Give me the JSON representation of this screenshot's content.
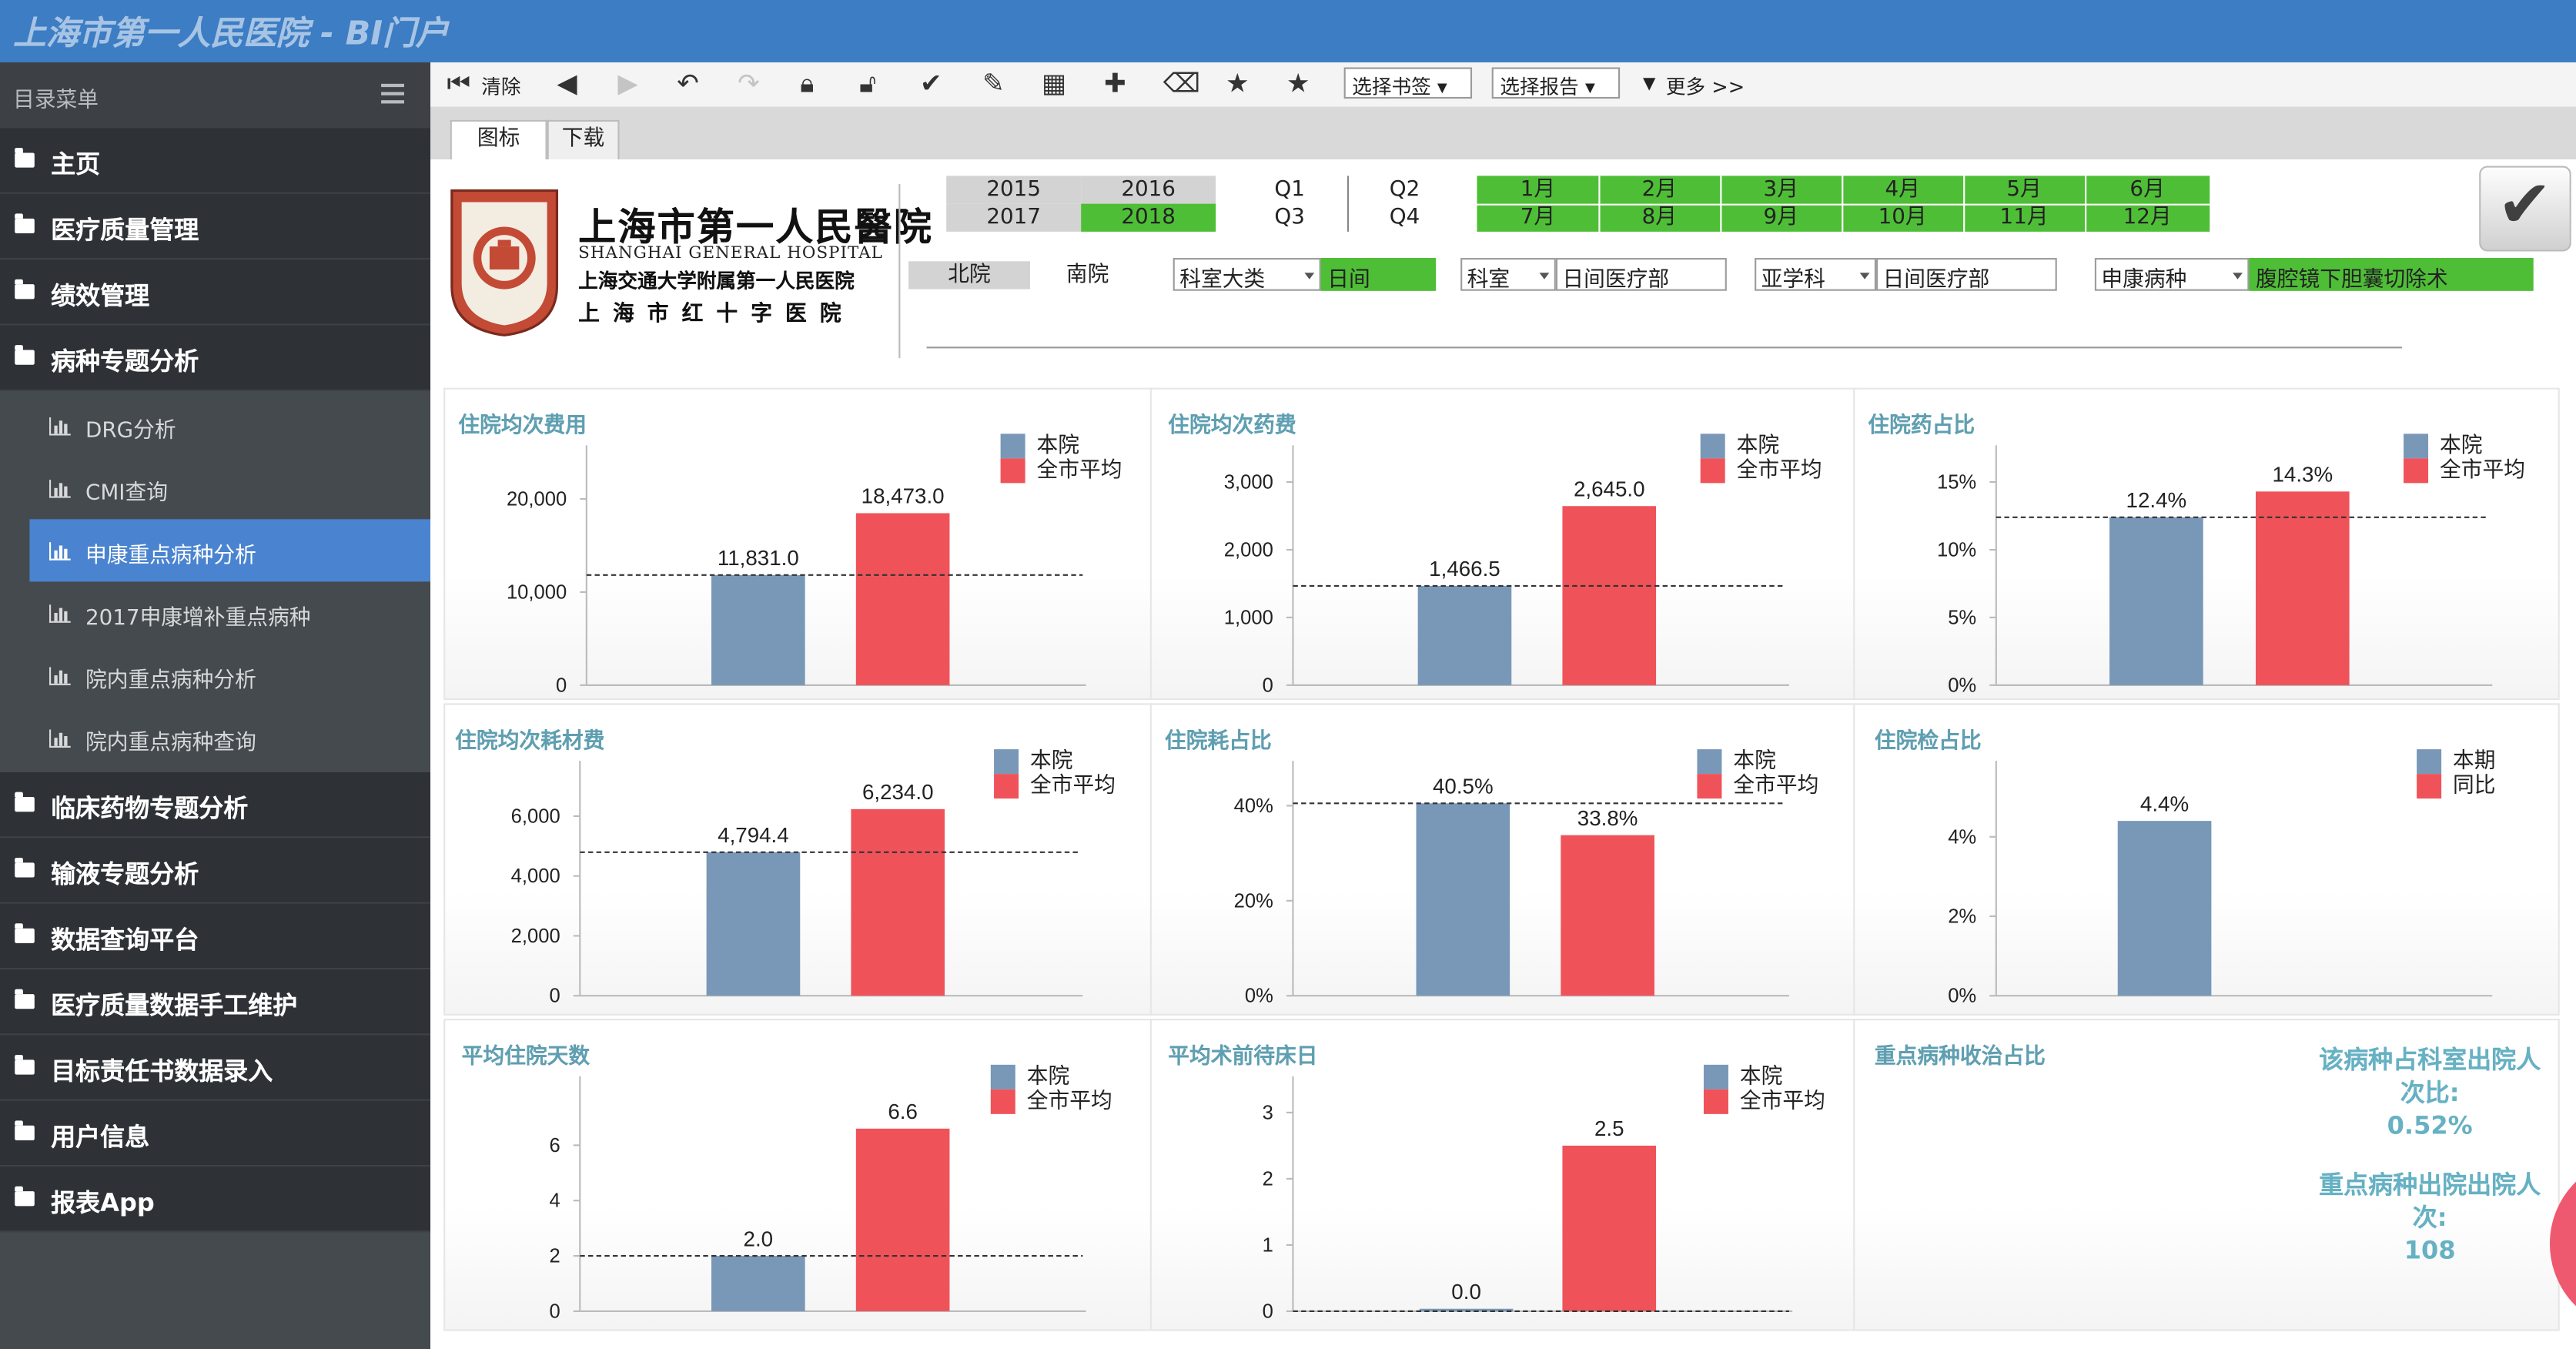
{
  "app": {
    "title": "上海市第一人民医院 - BI门户"
  },
  "sidebar": {
    "header": "目录菜单",
    "items": [
      {
        "label": "主页"
      },
      {
        "label": "医疗质量管理"
      },
      {
        "label": "绩效管理"
      },
      {
        "label": "病种专题分析"
      },
      {
        "label": "临床药物专题分析"
      },
      {
        "label": "输液专题分析"
      },
      {
        "label": "数据查询平台"
      },
      {
        "label": "医疗质量数据手工维护"
      },
      {
        "label": "目标责任书数据录入"
      },
      {
        "label": "用户信息"
      },
      {
        "label": "报表App"
      }
    ],
    "subitems": [
      {
        "label": "DRG分析"
      },
      {
        "label": "CMI查询"
      },
      {
        "label": "申康重点病种分析"
      },
      {
        "label": "2017申康增补重点病种"
      },
      {
        "label": "院内重点病种分析"
      },
      {
        "label": "院内重点病种查询"
      }
    ],
    "active_subitem": "申康重点病种分析"
  },
  "toolbar": {
    "clear_label": "清除",
    "bookmark_select": "选择书签",
    "report_select": "选择报告",
    "more_label": "更多 >>"
  },
  "tabs": [
    {
      "label": "图标"
    },
    {
      "label": "下载"
    }
  ],
  "logo": {
    "name_cn": "上海市第一人民醫院",
    "name_en": "SHANGHAI GENERAL HOSPITAL",
    "affiliation": "上海交通大学附属第一人民医院",
    "alt_name": "上海市红十字医院",
    "seal_text": "上海市第一人民医院"
  },
  "filters": {
    "years": {
      "row1": [
        "2015",
        "2016"
      ],
      "row2": [
        "2017",
        "2018"
      ],
      "selected": "2018"
    },
    "quarters": {
      "row1": [
        "Q1",
        "Q2"
      ],
      "row2": [
        "Q3",
        "Q4"
      ]
    },
    "months": {
      "row1": [
        "1月",
        "2月",
        "3月",
        "4月",
        "5月",
        "6月"
      ],
      "row2": [
        "7月",
        "8月",
        "9月",
        "10月",
        "11月",
        "12月"
      ]
    },
    "campus": {
      "north": "北院",
      "south": "南院",
      "selected": "北院"
    },
    "dept_category": {
      "label": "科室大类",
      "value": "日间"
    },
    "dept": {
      "label": "科室",
      "value": "日间医疗部"
    },
    "subspecialty": {
      "label": "亚学科",
      "value": "日间医疗部"
    },
    "disease": {
      "label": "申康病种",
      "value": "腹腔镜下胆囊切除术"
    }
  },
  "colors": {
    "hospital": "#7998b8",
    "city": "#ef5359",
    "accent_green": "#4fbe37",
    "title_teal": "#5f9fb1",
    "header_blue": "#3c7dc4"
  },
  "legend": {
    "hospital": "本院",
    "city_avg": "全市平均",
    "current": "本期",
    "yoy": "同比"
  },
  "chart_data": [
    {
      "type": "bar",
      "title": "住院均次费用",
      "categories": [
        "本院",
        "全市平均"
      ],
      "values": [
        11831.0,
        18473.0
      ],
      "labels": [
        "11,831.0",
        "18,473.0"
      ],
      "yticks": [
        0,
        10000,
        20000
      ],
      "ytick_labels": [
        "0",
        "10,000",
        "20,000"
      ],
      "ylim": [
        0,
        24000
      ],
      "reference_line": 11831.0
    },
    {
      "type": "bar",
      "title": "住院均次药费",
      "categories": [
        "本院",
        "全市平均"
      ],
      "values": [
        1466.5,
        2645.0
      ],
      "labels": [
        "1,466.5",
        "2,645.0"
      ],
      "yticks": [
        0,
        1000,
        2000,
        3000
      ],
      "ytick_labels": [
        "0",
        "1,000",
        "2,000",
        "3,000"
      ],
      "ylim": [
        0,
        3300
      ],
      "reference_line": 1466.5
    },
    {
      "type": "bar",
      "title": "住院药占比",
      "categories": [
        "本院",
        "全市平均"
      ],
      "values": [
        12.4,
        14.3
      ],
      "labels": [
        "12.4%",
        "14.3%"
      ],
      "yticks": [
        0,
        5,
        10,
        15
      ],
      "ytick_labels": [
        "0%",
        "5%",
        "10%",
        "15%"
      ],
      "ylim": [
        0,
        16.5
      ],
      "reference_line": 12.4
    },
    {
      "type": "bar",
      "title": "住院均次耗材费",
      "categories": [
        "本院",
        "全市平均"
      ],
      "values": [
        4794.4,
        6234.0
      ],
      "labels": [
        "4,794.4",
        "6,234.0"
      ],
      "yticks": [
        0,
        2000,
        4000,
        6000
      ],
      "ytick_labels": [
        "0",
        "2,000",
        "4,000",
        "6,000"
      ],
      "ylim": [
        0,
        7300
      ],
      "reference_line": 4794.4
    },
    {
      "type": "bar",
      "title": "住院耗占比",
      "categories": [
        "本院",
        "全市平均"
      ],
      "values": [
        40.5,
        33.8
      ],
      "labels": [
        "40.5%",
        "33.8%"
      ],
      "yticks": [
        0,
        20,
        40
      ],
      "ytick_labels": [
        "0%",
        "20%",
        "40%"
      ],
      "ylim": [
        0,
        46
      ],
      "reference_line": 40.5
    },
    {
      "type": "bar",
      "title": "住院检占比",
      "categories": [
        "本期"
      ],
      "values": [
        4.4
      ],
      "labels": [
        "4.4%"
      ],
      "yticks": [
        0,
        2,
        4
      ],
      "ytick_labels": [
        "0%",
        "2%",
        "4%"
      ],
      "ylim": [
        0,
        5.5
      ]
    },
    {
      "type": "bar",
      "title": "平均住院天数",
      "categories": [
        "本院",
        "全市平均"
      ],
      "values": [
        2.0,
        6.6
      ],
      "labels": [
        "2.0",
        "6.6"
      ],
      "yticks": [
        0,
        2,
        4,
        6
      ],
      "ytick_labels": [
        "0",
        "2",
        "4",
        "6"
      ],
      "ylim": [
        0,
        7.9
      ],
      "reference_line": 2.0
    },
    {
      "type": "bar",
      "title": "平均术前待床日",
      "categories": [
        "本院",
        "全市平均"
      ],
      "values": [
        0.0,
        2.5
      ],
      "labels": [
        "0.0",
        "2.5"
      ],
      "yticks": [
        0,
        1,
        2,
        3
      ],
      "ytick_labels": [
        "0",
        "1",
        "2",
        "3"
      ],
      "ylim": [
        0,
        3.3
      ],
      "reference_line": 0.0
    },
    {
      "type": "pie",
      "title": "重点病种收治占比",
      "slices": [
        {
          "label": "该病种占科室出院人次比",
          "value": 0.52,
          "display": "0.52%"
        },
        {
          "label": "重点病种出院出院人次",
          "value": 108,
          "display": "108"
        }
      ]
    }
  ],
  "donut": {
    "label1_line1": "该病种占科室出院人",
    "label1_line2": "次比:",
    "label1_value": "0.52%",
    "label2_line1": "重点病种出院出院人",
    "label2_line2": "次:",
    "label2_value": "108"
  }
}
